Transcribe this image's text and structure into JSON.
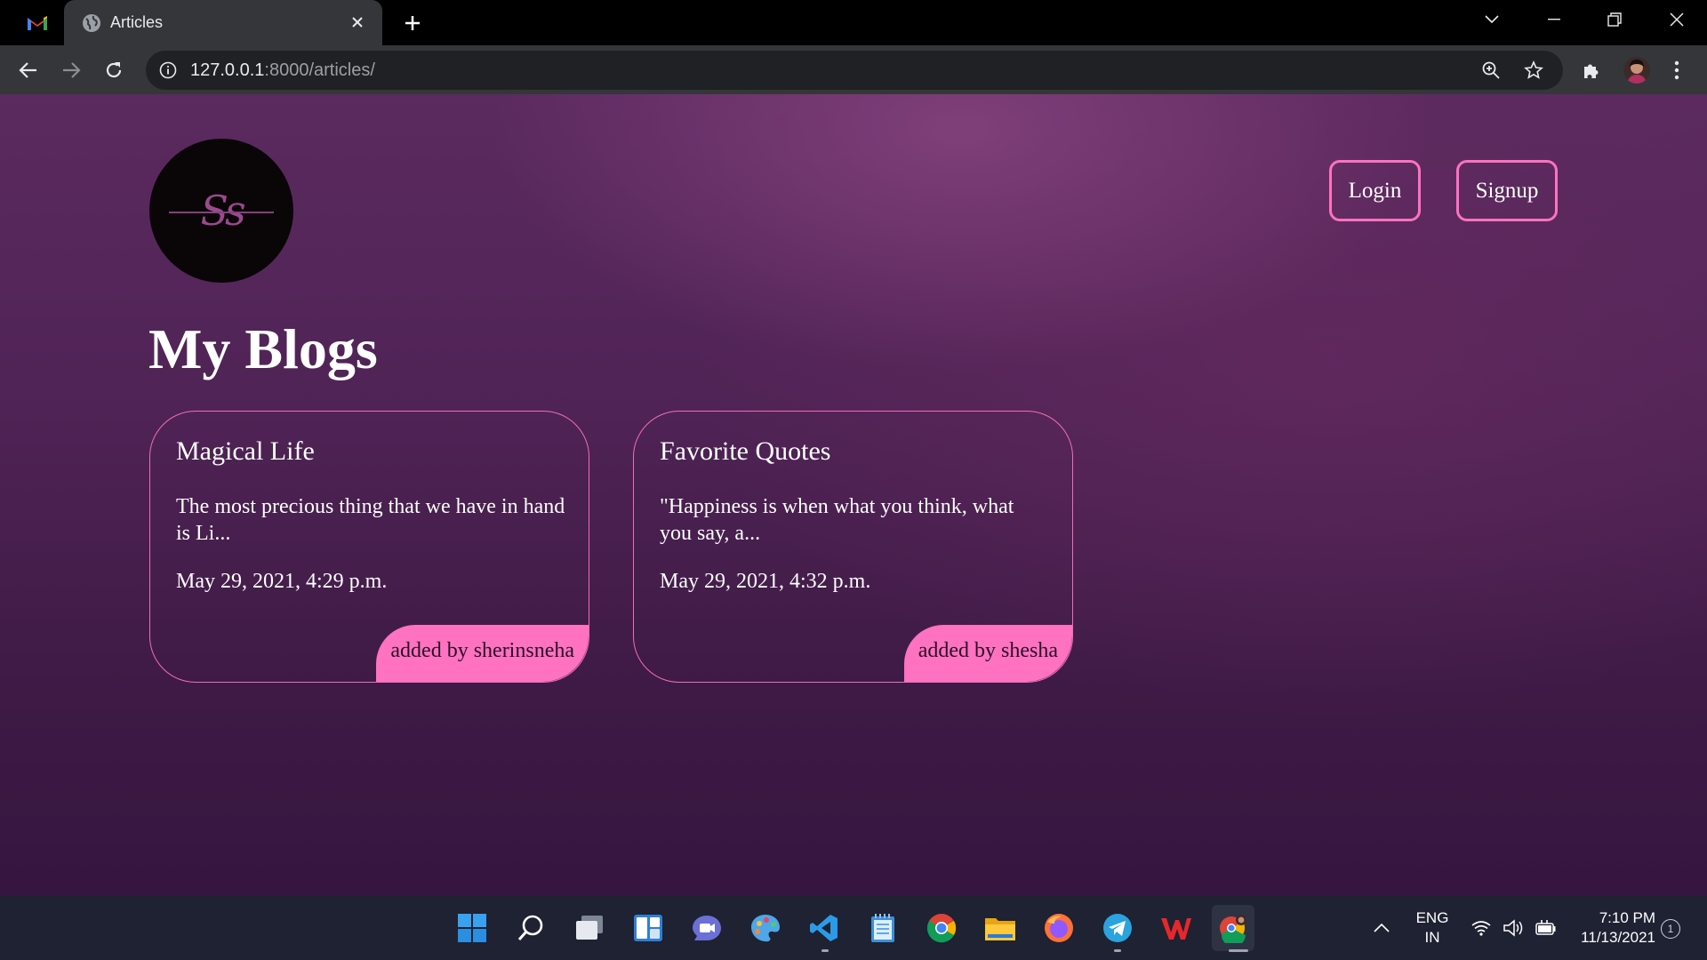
{
  "browser": {
    "tab_title": "Articles",
    "url_host": "127.0.0.1",
    "url_rest": ":8000/articles/"
  },
  "page": {
    "nav": {
      "login_label": "Login",
      "signup_label": "Signup"
    },
    "logo_text": "Ss",
    "heading": "My Blogs",
    "articles": [
      {
        "title": "Magical Life",
        "excerpt": "The most precious thing that we have in hand is Li...",
        "date": "May 29, 2021, 4:29 p.m.",
        "author": "added by sherinsneha"
      },
      {
        "title": "Favorite Quotes",
        "excerpt": "\"Happiness is when what you think, what you say, a...",
        "date": "May 29, 2021, 4:32 p.m.",
        "author": "added by shesha"
      }
    ],
    "colors": {
      "accent": "#ff72c0",
      "background": "#4f2355"
    }
  },
  "taskbar": {
    "apps": [
      "start-icon",
      "search-icon",
      "task-view-icon",
      "widgets-icon",
      "teams-chat-icon",
      "paint-icon",
      "vscode-icon",
      "notepad-icon",
      "chrome-icon",
      "file-explorer-icon",
      "firefox-icon",
      "telegram-icon",
      "wps-office-icon",
      "chrome-profile-icon"
    ],
    "language": "ENG",
    "region": "IN",
    "time": "7:10 PM",
    "date": "11/13/2021",
    "notification_count": "1"
  }
}
